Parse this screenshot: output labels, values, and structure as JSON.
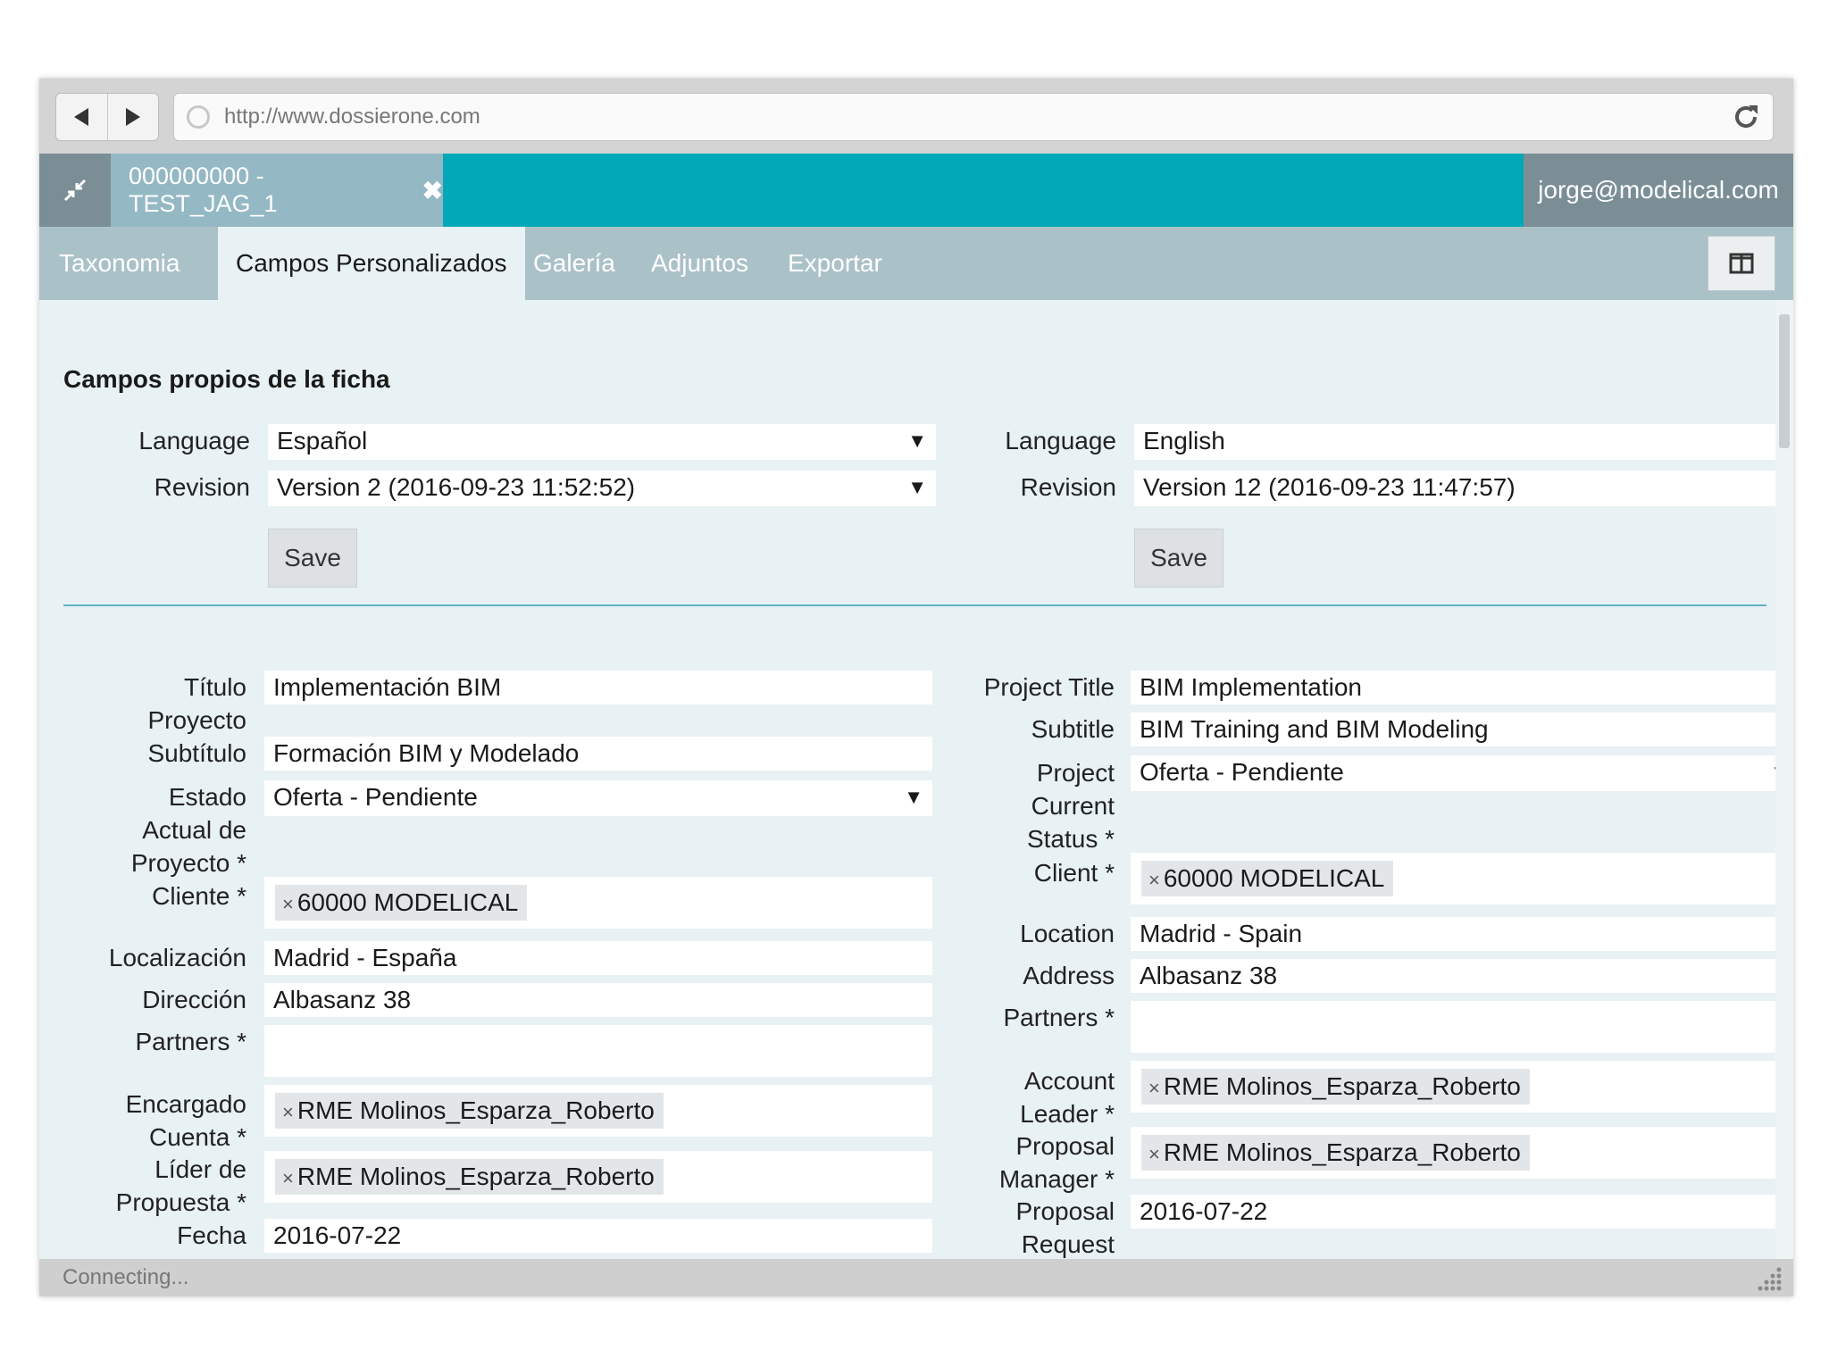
{
  "browser": {
    "url": "http://www.dossierone.com"
  },
  "app": {
    "document_tab": "000000000 - TEST_JAG_1",
    "user_email": "jorge@modelical.com"
  },
  "tabs": [
    "Taxonomia",
    "Campos Personalizados",
    "Galería",
    "Adjuntos",
    "Exportar"
  ],
  "active_tab": "Campos Personalizados",
  "section_title": "Campos propios de la ficha",
  "left": {
    "language_label": "Language",
    "language_value": "Español",
    "revision_label": "Revision",
    "revision_value": "Version 2 (2016-09-23 11:52:52)",
    "save_label": "Save",
    "fields": {
      "titulo_label_1": "Título",
      "titulo_label_2": "Proyecto",
      "titulo_value": "Implementación BIM",
      "subtitulo_label": "Subtítulo",
      "subtitulo_value": "Formación BIM y Modelado",
      "estado_label_1": "Estado",
      "estado_label_2": "Actual de",
      "estado_label_3": "Proyecto *",
      "estado_value": "Oferta - Pendiente",
      "cliente_label": "Cliente *",
      "cliente_chip": "60000 MODELICAL",
      "localizacion_label": "Localización",
      "localizacion_value": "Madrid - España",
      "direccion_label": "Dirección",
      "direccion_value": "Albasanz 38",
      "partners_label": "Partners *",
      "encargado_label_1": "Encargado",
      "encargado_label_2": "Cuenta *",
      "encargado_chip": "RME Molinos_Esparza_Roberto",
      "lider_label_1": "Líder de",
      "lider_label_2": "Propuesta *",
      "lider_chip": "RME Molinos_Esparza_Roberto",
      "fecha_label": "Fecha",
      "fecha_value": "2016-07-22"
    }
  },
  "right": {
    "language_label": "Language",
    "language_value": "English",
    "revision_label": "Revision",
    "revision_value": "Version 12 (2016-09-23 11:47:57)",
    "save_label": "Save",
    "fields": {
      "title_label": "Project Title",
      "title_value": "BIM Implementation",
      "subtitle_label": "Subtitle",
      "subtitle_value": "BIM Training and BIM Modeling",
      "status_label_1": "Project",
      "status_label_2": "Current",
      "status_label_3": "Status *",
      "status_value": "Oferta - Pendiente",
      "client_label": "Client *",
      "client_chip": "60000 MODELICAL",
      "location_label": "Location",
      "location_value": "Madrid - Spain",
      "address_label": "Address",
      "address_value": "Albasanz 38",
      "partners_label": "Partners *",
      "account_label_1": "Account",
      "account_label_2": "Leader *",
      "account_chip": "RME Molinos_Esparza_Roberto",
      "proposal_label_1": "Proposal",
      "proposal_label_2": "Manager *",
      "proposal_chip": "RME Molinos_Esparza_Roberto",
      "request_label_1": "Proposal",
      "request_label_2": "Request",
      "request_value": "2016-07-22"
    }
  },
  "status_text": "Connecting...",
  "chip_remove_glyph": "×",
  "caret_glyph": "▼",
  "close_glyph": "✖",
  "colors": {
    "appbar": "#03a8b8",
    "tabs": "#abc1c8",
    "content_bg": "#e8f1f4",
    "divider": "#5fb2c2"
  }
}
